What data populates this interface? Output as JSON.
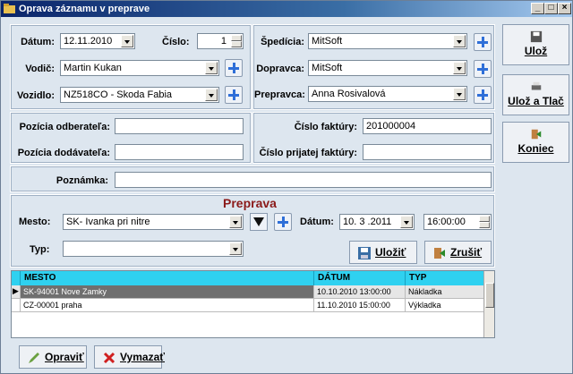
{
  "window": {
    "title": "Oprava záznamu v preprave"
  },
  "form": {
    "datum_label": "Dátum:",
    "datum_value": "12.11.2010",
    "cislo_label": "Číslo:",
    "cislo_value": "1",
    "vodic_label": "Vodič:",
    "vodic_value": "Martin  Kukan",
    "vozidlo_label": "Vozidlo:",
    "vozidlo_value": "NZ518CO - Skoda Fabia",
    "spedicia_label": "Špedícia:",
    "spedicia_value": "MitSoft",
    "dopravca_label": "Dopravca:",
    "dopravca_value": "MitSoft",
    "prepravca_label": "Prepravca:",
    "prepravca_value": "Anna Rosivalová",
    "poz_odb_label": "Pozícia odberateľa:",
    "poz_odb_value": "",
    "poz_dod_label": "Pozícia dodávateľa:",
    "poz_dod_value": "",
    "cislo_fakt_label": "Číslo faktúry:",
    "cislo_fakt_value": "201000004",
    "cislo_prij_label": "Číslo prijatej faktúry:",
    "cislo_prij_value": "",
    "poznamka_label": "Poznámka:",
    "poznamka_value": ""
  },
  "preprava": {
    "header": "Preprava",
    "mesto_label": "Mesto:",
    "mesto_value": "SK-  Ivanka pri nitre",
    "datum_label": "Dátum:",
    "datum_value": "10. 3 .2011",
    "time_value": "16:00:00",
    "typ_label": "Typ:",
    "typ_value": "",
    "ulozit_label": "Uložiť",
    "zrusit_label": "Zrušiť"
  },
  "sidebar": {
    "uloz_label": "Ulož",
    "uloz_tlac_label": "Ulož a Tlač",
    "koniec_label": "Koniec"
  },
  "grid": {
    "headers": [
      "MESTO",
      "DÁTUM",
      "TYP"
    ],
    "rows": [
      {
        "mesto": "SK-94001  Nove Zamky",
        "datum": "10.10.2010 13:00:00",
        "typ": "Nákladka"
      },
      {
        "mesto": "CZ-00001  praha",
        "datum": "11.10.2010 15:00:00",
        "typ": "Výkladka"
      }
    ]
  },
  "bottom": {
    "opravit_label": "Opraviť",
    "vymazat_label": "Vymazať"
  },
  "colors": {
    "accent_header": "#2fd1f0",
    "preprava_title": "#8b1a1a"
  },
  "icons": [
    "floppy-icon",
    "printer-icon",
    "exit-icon",
    "plus-icon",
    "pencil-icon",
    "delete-x-icon",
    "cancel-icon"
  ]
}
